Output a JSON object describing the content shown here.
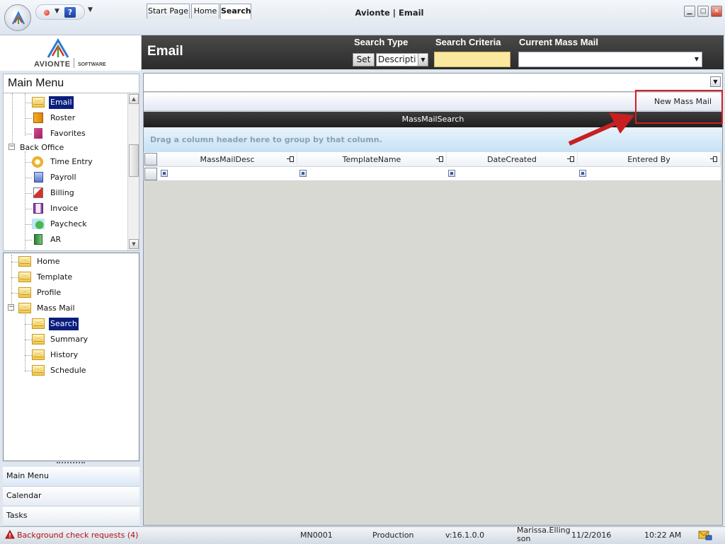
{
  "window": {
    "title": "Avionte | Email"
  },
  "logo": {
    "name": "AVIONTE",
    "sub": "SOFTWARE"
  },
  "header": {
    "title": "Email",
    "search_type_label": "Search Type",
    "search_criteria_label": "Search Criteria",
    "current_mass_mail_label": "Current Mass Mail",
    "set_button": "Set",
    "search_type_value": "Descripti",
    "search_criteria_value": "",
    "current_mass_mail_value": ""
  },
  "left": {
    "main_menu_title": "Main Menu",
    "top_tree": [
      {
        "label": "Email",
        "icon": "envelope-icon",
        "selected": true
      },
      {
        "label": "Roster",
        "icon": "roster-icon"
      },
      {
        "label": "Favorites",
        "icon": "favorites-icon"
      },
      {
        "label": "Back Office",
        "icon": "",
        "group": true
      },
      {
        "label": "Time Entry",
        "icon": "time-entry-icon"
      },
      {
        "label": "Payroll",
        "icon": "payroll-icon"
      },
      {
        "label": "Billing",
        "icon": "billing-icon"
      },
      {
        "label": "Invoice",
        "icon": "invoice-icon"
      },
      {
        "label": "Paycheck",
        "icon": "paycheck-icon"
      },
      {
        "label": "AR",
        "icon": "ar-icon"
      }
    ],
    "bottom_tree": [
      {
        "label": "Home"
      },
      {
        "label": "Template"
      },
      {
        "label": "Profile"
      },
      {
        "label": "Mass Mail",
        "group": true
      },
      {
        "label": "Search",
        "selected": true
      },
      {
        "label": "Summary"
      },
      {
        "label": "History"
      },
      {
        "label": "Schedule"
      }
    ],
    "nav_buttons": [
      "Main Menu",
      "Calendar",
      "Tasks"
    ]
  },
  "tabs": [
    "Start Page",
    "Home",
    "Search"
  ],
  "toolbar": {
    "new_mass_mail": "New Mass Mail"
  },
  "grid": {
    "title": "MassMailSearch",
    "group_hint": "Drag a column header here to group by that column.",
    "columns": [
      "MassMailDesc",
      "TemplateName",
      "DateCreated",
      "Entered By"
    ]
  },
  "status": {
    "alert": "Background check requests (4)",
    "code": "MN0001",
    "environment": "Production",
    "version": "v:16.1.0.0",
    "user_line1": "Marissa.Elling",
    "user_line2": "son",
    "date": "11/2/2016",
    "time": "10:22 AM"
  },
  "colors": {
    "accent_red": "#d02020",
    "selection_navy": "#0a1e7e",
    "header_dark": "#2b2b2b",
    "criteria_yellow": "#fae89e"
  }
}
